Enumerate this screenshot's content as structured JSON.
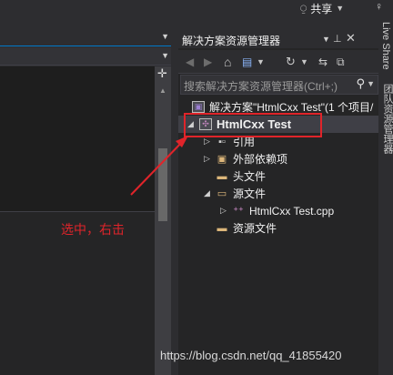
{
  "topbar": {
    "share_label": "共享",
    "share_caret": "▼",
    "person_icon": "person-icon"
  },
  "solution_explorer": {
    "title": "解决方案资源管理器",
    "title_icons": [
      "dropdown-icon",
      "pin-icon",
      "close-icon"
    ],
    "toolbar_icons": [
      "back-icon",
      "forward-icon",
      "home-icon",
      "switch-views-icon",
      "dropdown-icon",
      "history-icon",
      "dropdown-icon",
      "sync-icon",
      "collapse-icon"
    ],
    "search_placeholder": "搜索解决方案资源管理器(Ctrl+;)",
    "tree": [
      {
        "label": "解决方案\"HtmlCxx Test\"(1 个项目/",
        "icon": "solution-icon",
        "expander": ""
      },
      {
        "label": "HtmlCxx Test",
        "icon": "project-icon",
        "expander": "◢",
        "selected": true
      },
      {
        "label": "引用",
        "icon": "references-icon",
        "expander": "▷"
      },
      {
        "label": "外部依赖项",
        "icon": "external-deps-icon",
        "expander": "▷"
      },
      {
        "label": "头文件",
        "icon": "folder-icon",
        "expander": ""
      },
      {
        "label": "源文件",
        "icon": "folder-open-icon",
        "expander": "◢"
      },
      {
        "label": "HtmlCxx Test.cpp",
        "icon": "cpp-file-icon",
        "expander": "▷"
      },
      {
        "label": "资源文件",
        "icon": "folder-icon",
        "expander": ""
      }
    ]
  },
  "side_tabs": [
    "Live Share",
    "团队资源管理器"
  ],
  "annotation": {
    "text": "选中，右击",
    "color": "#e0242a"
  },
  "watermark": "https://blog.csdn.net/qq_41855420",
  "colors": {
    "background": "#2d2d30",
    "panel": "#252526",
    "accent": "#007acc",
    "highlight": "#e0242a"
  }
}
